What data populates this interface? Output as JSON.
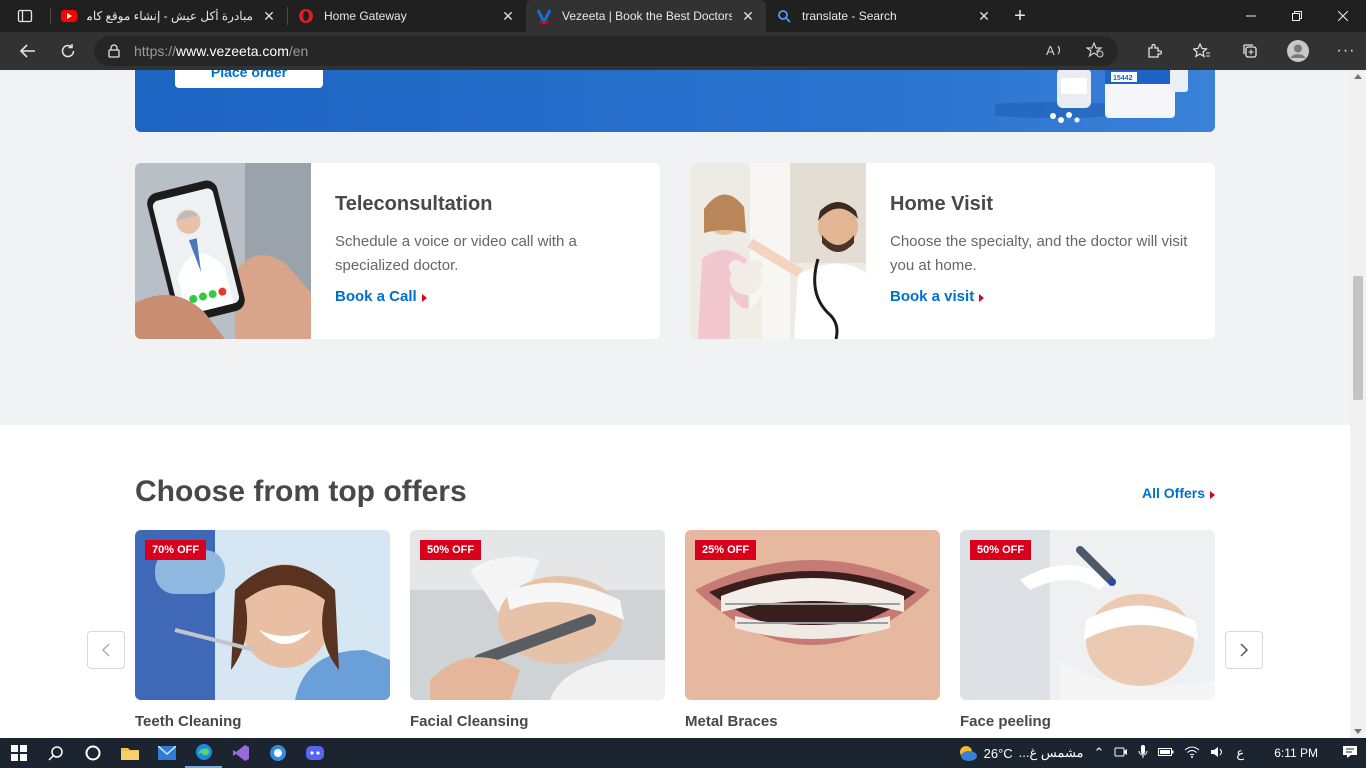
{
  "browser": {
    "tabs": [
      {
        "title": "مبادرة أكل عيش - إنشاء موقع كامل",
        "icon": "youtube-icon"
      },
      {
        "title": "Home Gateway",
        "icon": "opera-icon"
      },
      {
        "title": "Vezeeta | Book the Best Doctors",
        "icon": "vezeeta-icon",
        "active": true
      },
      {
        "title": "translate - Search",
        "icon": "search-icon"
      }
    ],
    "url": {
      "prefix": "https://",
      "host": "www.vezeeta.com",
      "path": "/en"
    }
  },
  "banner": {
    "place_order_label": "Place order",
    "box_label": "15442"
  },
  "services": [
    {
      "title": "Teleconsultation",
      "description": "Schedule a voice or video call with a specialized doctor.",
      "link": "Book a Call"
    },
    {
      "title": "Home Visit",
      "description": "Choose the specialty, and the doctor will visit you at home.",
      "link": "Book a visit"
    }
  ],
  "offers": {
    "title": "Choose from top offers",
    "all_label": "All Offers",
    "items": [
      {
        "badge": "70% OFF",
        "name": "Teeth Cleaning"
      },
      {
        "badge": "50% OFF",
        "name": "Facial Cleansing"
      },
      {
        "badge": "25% OFF",
        "name": "Metal Braces"
      },
      {
        "badge": "50% OFF",
        "name": "Face peeling"
      }
    ]
  },
  "taskbar": {
    "temperature": "26°C",
    "weather_text": "مشمس غ...",
    "lang": "ع",
    "time": "6:11 PM"
  },
  "colors": {
    "brand_blue": "#0070cd",
    "badge_red": "#d9001b",
    "banner_blue": "#2a73cf"
  }
}
